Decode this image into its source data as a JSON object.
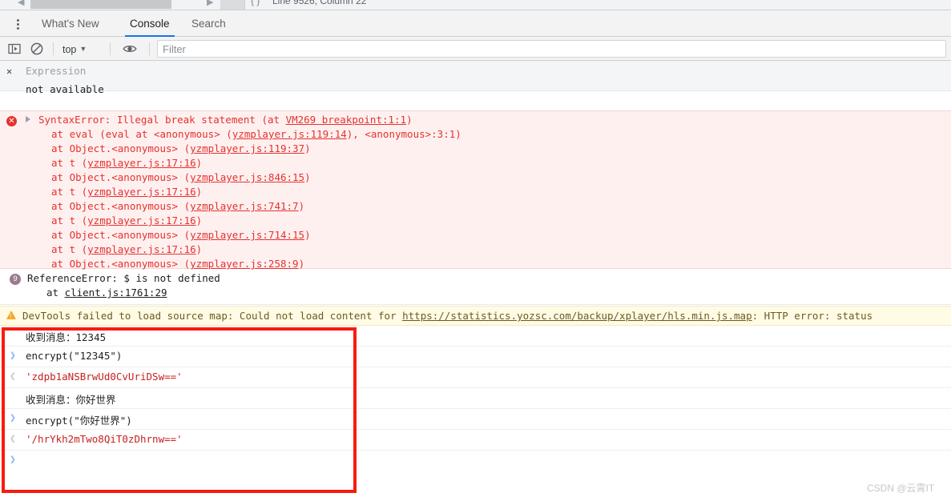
{
  "topstrip": {
    "line_column": "Line 9526, Column 22",
    "code_icon": "{ }",
    "arrow_left": "◀",
    "arrow_right": "▶"
  },
  "tabs": {
    "kebab_icon": "more-vertical-icon",
    "items": [
      {
        "id": "whatsnew",
        "label": "What's New",
        "active": false
      },
      {
        "id": "console",
        "label": "Console",
        "active": true
      },
      {
        "id": "search",
        "label": "Search",
        "active": false
      }
    ]
  },
  "toolbar": {
    "sidebar_toggle_icon": "sidebar-toggle-icon",
    "clear_console_icon": "clear-console-icon",
    "context_selector": "top",
    "context_caret": "▼",
    "eye_icon": "eye-icon",
    "filter_placeholder": "Filter",
    "filter_value": ""
  },
  "console": {
    "expression": {
      "close_icon": "✕",
      "label": "Expression",
      "value": "not available"
    },
    "syntax_error": {
      "icon": "✕",
      "expand_icon": "expand-triangle-icon",
      "title_prefix": "SyntaxError: Illegal break statement (at ",
      "title_link": "VM269 breakpoint:1:1",
      "title_suffix": ")",
      "stack": [
        {
          "pre": "at eval (eval at <anonymous> (",
          "link": "yzmplayer.js:119:14",
          "post": "), <anonymous>:3:1)"
        },
        {
          "pre": "at Object.<anonymous> (",
          "link": "yzmplayer.js:119:37",
          "post": ")"
        },
        {
          "pre": "at t (",
          "link": "yzmplayer.js:17:16",
          "post": ")"
        },
        {
          "pre": "at Object.<anonymous> (",
          "link": "yzmplayer.js:846:15",
          "post": ")"
        },
        {
          "pre": "at t (",
          "link": "yzmplayer.js:17:16",
          "post": ")"
        },
        {
          "pre": "at Object.<anonymous> (",
          "link": "yzmplayer.js:741:7",
          "post": ")"
        },
        {
          "pre": "at t (",
          "link": "yzmplayer.js:17:16",
          "post": ")"
        },
        {
          "pre": "at Object.<anonymous> (",
          "link": "yzmplayer.js:714:15",
          "post": ")"
        },
        {
          "pre": "at t (",
          "link": "yzmplayer.js:17:16",
          "post": ")"
        },
        {
          "pre": "at Object.<anonymous> (",
          "link": "yzmplayer.js:258:9",
          "post": ")"
        }
      ]
    },
    "reference_error": {
      "count_badge": "9",
      "title": "ReferenceError: $ is not defined",
      "stack_pre": "at ",
      "stack_link": "client.js:1761:29"
    },
    "warning": {
      "icon": "warning-triangle-icon",
      "text_pre": "DevTools failed to load source map: Could not load content for ",
      "text_link": "https://statistics.yozsc.com/backup/xplayer/hls.min.js.map",
      "text_post": ": HTTP error: status"
    },
    "interactions": [
      {
        "gutter": "",
        "kind": "plain",
        "text": "收到消息：12345"
      },
      {
        "gutter": "❯",
        "kind": "code",
        "text": "encrypt(\"12345\")"
      },
      {
        "gutter": "❮",
        "kind": "result",
        "text": "'zdpb1aNSBrwUd0CvUriDSw=='"
      },
      {
        "gutter": "",
        "kind": "plain",
        "text": "收到消息：你好世界"
      },
      {
        "gutter": "❯",
        "kind": "code",
        "text": "encrypt(\"你好世界\")"
      },
      {
        "gutter": "❮",
        "kind": "result",
        "text": "'/hrYkh2mTwo8QiT0zDhrnw=='"
      },
      {
        "gutter": "❯",
        "kind": "code",
        "text": ""
      }
    ]
  },
  "annotation": {
    "color": "#f81c0e"
  },
  "watermark": {
    "text": "CSDN @云霄IT"
  }
}
